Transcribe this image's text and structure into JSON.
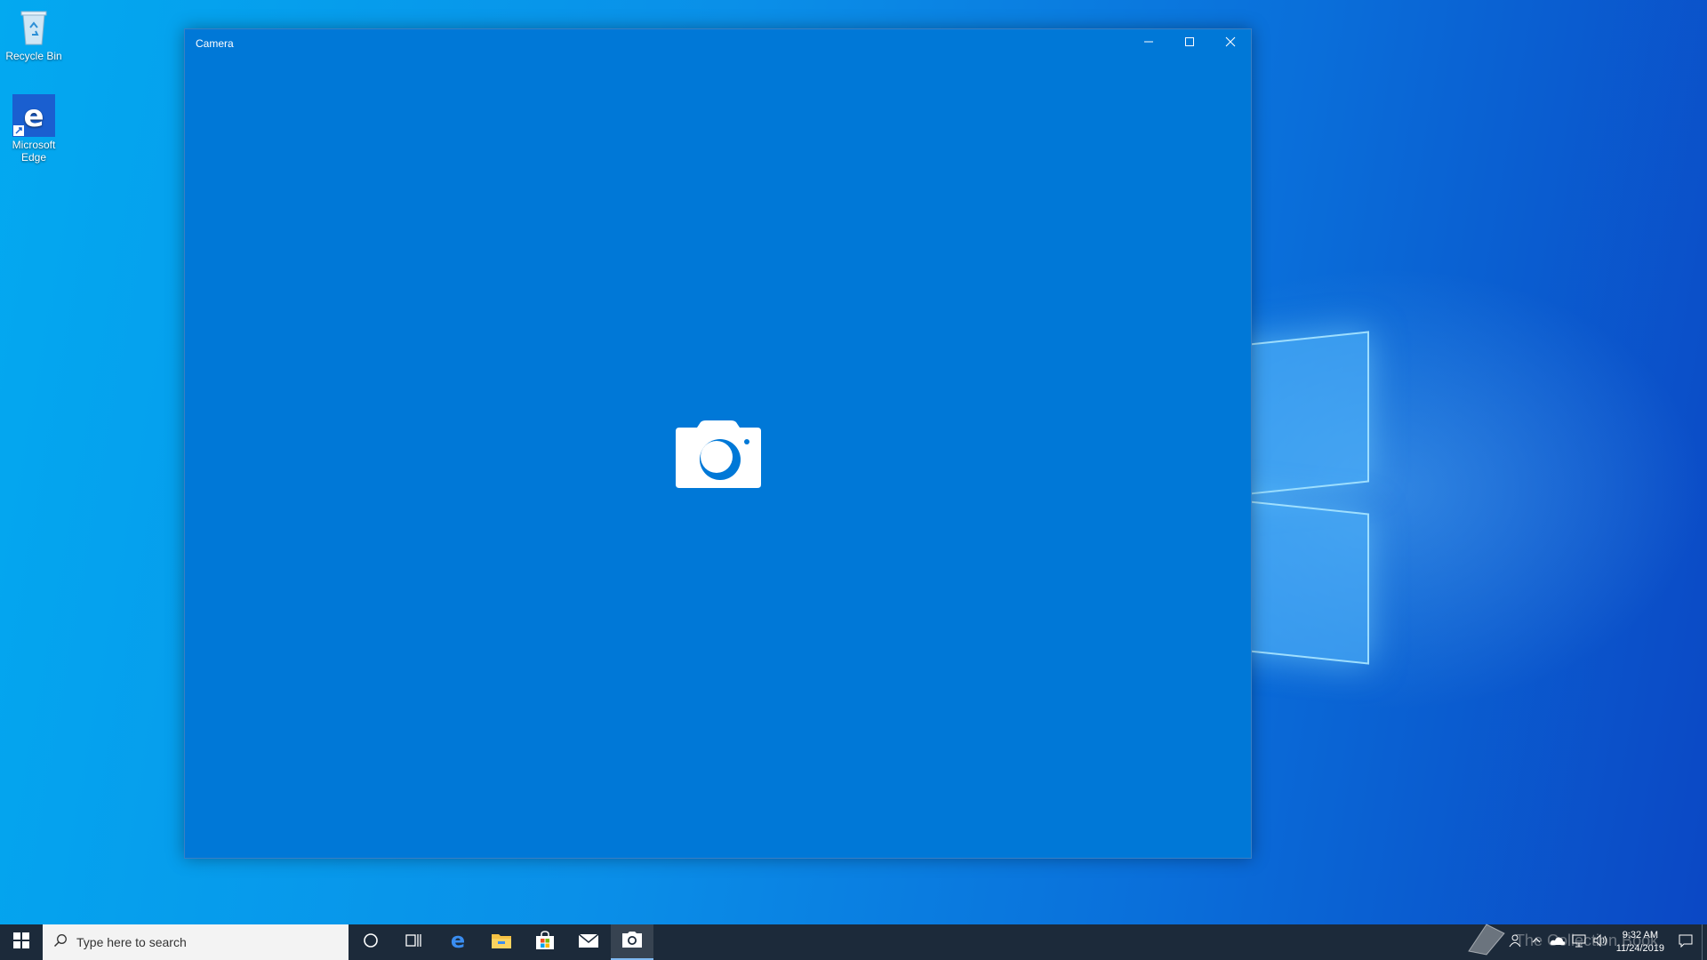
{
  "desktop": {
    "icons": [
      {
        "label": "Recycle Bin",
        "icon": "recycle-bin-icon"
      },
      {
        "label": "Microsoft Edge",
        "icon": "edge-icon"
      }
    ]
  },
  "window": {
    "title": "Camera",
    "controls": [
      "minimize-icon",
      "maximize-icon",
      "close-icon"
    ],
    "placeholder_icon": "camera-icon",
    "background": "#0078d7"
  },
  "taskbar": {
    "search_placeholder": "Type here to search",
    "pinned": [
      "cortana-icon",
      "task-view-icon",
      "edge-icon",
      "file-explorer-icon",
      "store-icon",
      "mail-icon",
      "camera-icon"
    ],
    "active_app": "camera-icon",
    "clock": {
      "time": "9:32 AM",
      "date": "11/24/2019"
    }
  },
  "watermark": {
    "text": "The Collection Book"
  }
}
